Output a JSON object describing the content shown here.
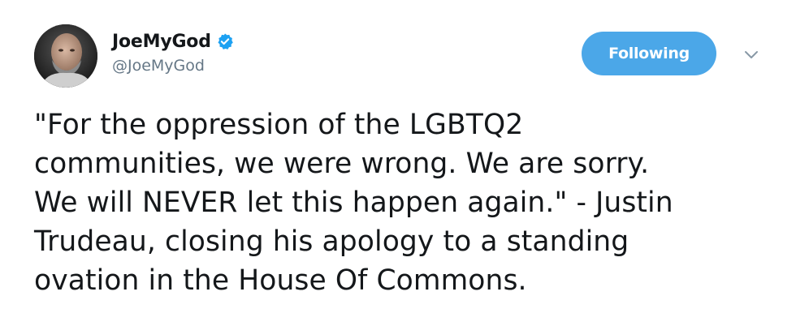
{
  "author": {
    "display_name": "JoeMyGod",
    "handle": "@JoeMyGod",
    "verified": true,
    "avatar_icon": "user-avatar-photo"
  },
  "actions": {
    "follow_label": "Following",
    "more_icon": "chevron-down-icon"
  },
  "tweet": {
    "text": "\"For the oppression of the LGBTQ2\ncommunities, we were wrong. We are sorry.\nWe will NEVER let this happen again.\" - Justin\nTrudeau, closing his apology to a standing\novation in the House Of Commons."
  },
  "colors": {
    "accent": "#4ba7e8",
    "verified_badge": "#1da1f2",
    "secondary_text": "#657786",
    "primary_text": "#14171a"
  }
}
